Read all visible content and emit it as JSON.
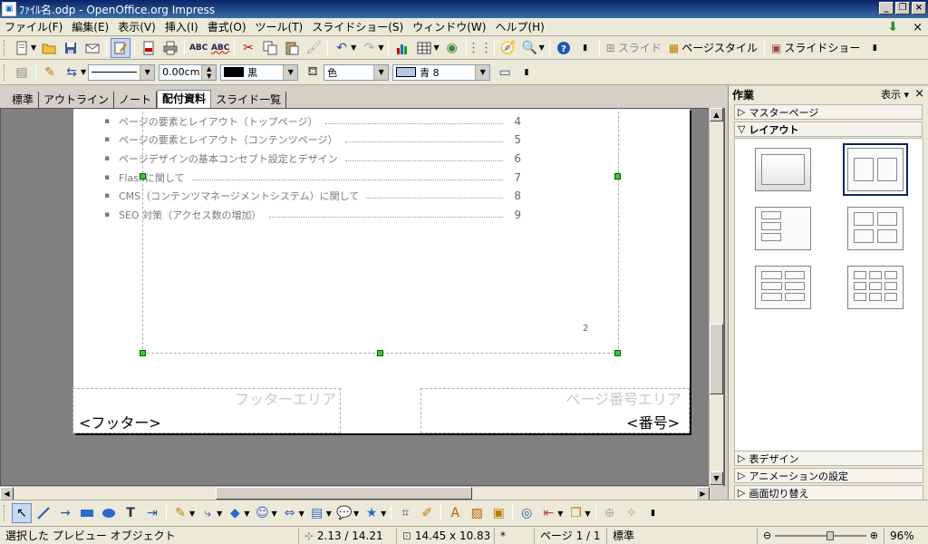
{
  "window": {
    "title": "ﾌｧｲﾙ名.odp - OpenOffice.org Impress"
  },
  "menu": {
    "items": [
      "ファイル(F)",
      "編集(E)",
      "表示(V)",
      "挿入(I)",
      "書式(O)",
      "ツール(T)",
      "スライドショー(S)",
      "ウィンドウ(W)",
      "ヘルプ(H)"
    ]
  },
  "toolbar": {
    "slide_label": "スライド",
    "page_style_label": "ページスタイル",
    "slideshow_label": "スライドショー"
  },
  "format_bar": {
    "line_width": "0.00cm",
    "line_color": "黒",
    "area_style": "色",
    "area_color": "青 8"
  },
  "view_tabs": [
    "標準",
    "アウトライン",
    "ノート",
    "配付資料",
    "スライド一覧"
  ],
  "slide": {
    "toc": [
      {
        "text": "ページの要素とレイアウト（トップページ）",
        "page": "4"
      },
      {
        "text": "ページの要素とレイアウト（コンテンツページ）",
        "page": "5"
      },
      {
        "text": "ページデザインの基本コンセプト設定とデザイン",
        "page": "6"
      },
      {
        "text": "Flashに関して",
        "page": "7"
      },
      {
        "text": "CMS（コンテンツマネージメントシステム）に関して",
        "page": "8"
      },
      {
        "text": "SEO 対策（アクセス数の増加）",
        "page": "9"
      }
    ],
    "page_number": "2",
    "footer_title": "フッターエリア",
    "footer_text": "<フッター>",
    "pagenum_title": "ページ番号エリア",
    "pagenum_text": "<番号>"
  },
  "taskpane": {
    "title": "作業",
    "view_label": "表示",
    "master_pages": "マスターページ",
    "layout": "レイアウト",
    "table_design": "表デザイン",
    "animation": "アニメーションの設定",
    "transition": "画面切り替え"
  },
  "status": {
    "selection": "選択した プレビュー オブジェクト",
    "position": "2.13 / 14.21",
    "size": "14.45 x 10.83",
    "modified": "*",
    "page": "ページ 1 / 1",
    "style": "標準",
    "zoom": "96%",
    "zoom_slider_level_percent": 60
  },
  "colors": {
    "line_color": "#000000",
    "area_color": "#b4c8e6",
    "titlebar": "#0a246a"
  }
}
